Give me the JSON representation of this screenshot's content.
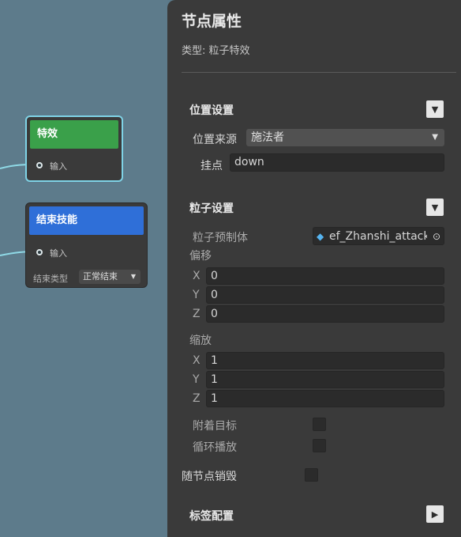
{
  "graph": {
    "node_effect": {
      "title": "特效",
      "input_label": "输入",
      "header_color": "#3aa04a"
    },
    "node_end": {
      "title": "结束技能",
      "input_label": "输入",
      "header_color": "#2f6fd8",
      "end_type_label": "结束类型",
      "end_type_value": "正常结束"
    }
  },
  "panel": {
    "title": "节点属性",
    "type_label": "类型: 粒子特效",
    "position_section": {
      "title": "位置设置",
      "source_label": "位置来源",
      "source_value": "施法者",
      "mount_label": "挂点",
      "mount_value": "down"
    },
    "particle_section": {
      "title": "粒子设置",
      "prefab_label": "粒子预制体",
      "prefab_value": "ef_Zhanshi_attack",
      "offset_label": "偏移",
      "offset": {
        "x_label": "X",
        "x": "0",
        "y_label": "Y",
        "y": "0",
        "z_label": "Z",
        "z": "0"
      },
      "scale_label": "缩放",
      "scale": {
        "x_label": "X",
        "x": "1",
        "y_label": "Y",
        "y": "1",
        "z_label": "Z",
        "z": "1"
      },
      "attach_target_label": "附着目标",
      "attach_target_checked": false,
      "loop_label": "循环播放",
      "loop_checked": false
    },
    "destroy_with_node_label": "随节点销毁",
    "destroy_with_node_checked": false,
    "tag_section": {
      "title": "标签配置"
    }
  },
  "icons": {
    "collapse": "triangle-down-icon",
    "expand": "triangle-right-icon",
    "dropdown": "chevron-down-icon",
    "prefab": "cube-icon",
    "picker": "target-icon"
  }
}
